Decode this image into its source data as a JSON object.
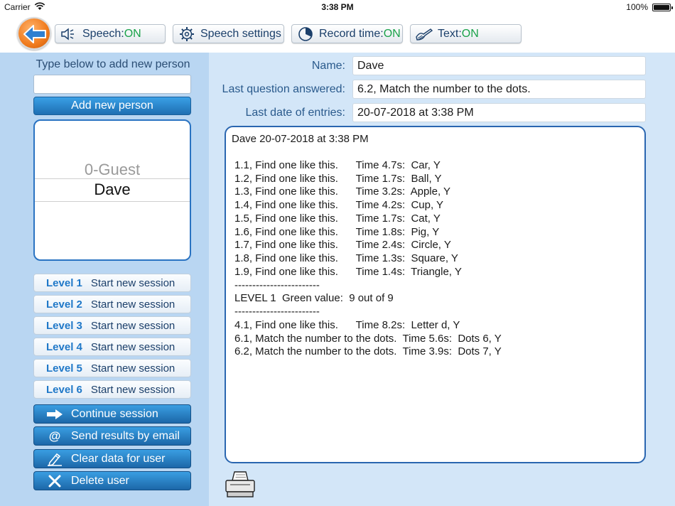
{
  "status_bar": {
    "carrier": "Carrier",
    "time": "3:38 PM",
    "battery": "100%"
  },
  "toolbar": {
    "speech": {
      "label": "Speech: ",
      "state": "ON"
    },
    "speech_settings": {
      "label": "Speech settings"
    },
    "record_time": {
      "label": "Record time: ",
      "state": "ON"
    },
    "text": {
      "label": "Text: ",
      "state": "ON"
    }
  },
  "sidebar": {
    "add_prompt": "Type below to add new person",
    "new_person_value": "",
    "add_button": "Add new person",
    "people": [
      "0-Guest",
      "Dave"
    ],
    "selected_person": "Dave",
    "levels": [
      {
        "level": "Level 1",
        "action": "Start new session"
      },
      {
        "level": "Level 2",
        "action": "Start new session"
      },
      {
        "level": "Level 3",
        "action": "Start new session"
      },
      {
        "level": "Level 4",
        "action": "Start new session"
      },
      {
        "level": "Level 5",
        "action": "Start new session"
      },
      {
        "level": "Level 6",
        "action": "Start new session"
      }
    ],
    "actions": {
      "continue": "Continue session",
      "email": "Send results by email",
      "clear": "Clear data for user",
      "delete": "Delete user"
    }
  },
  "main": {
    "name_label": "Name:",
    "name_value": "Dave",
    "last_question_label": "Last question answered:",
    "last_question_value": "6.2, Match the number to the dots.",
    "last_date_label": "Last date of entries:",
    "last_date_value": "20-07-2018 at 3:38 PM",
    "log_header": "Dave   20-07-2018 at 3:38 PM",
    "log_lines": [
      "1.1, Find one like this.      Time 4.7s:  Car, Y",
      "1.2, Find one like this.      Time 1.7s:  Ball, Y",
      "1.3, Find one like this.      Time 3.2s:  Apple, Y",
      "1.4, Find one like this.      Time 4.2s:  Cup, Y",
      "1.5, Find one like this.      Time 1.7s:  Cat, Y",
      "1.6, Find one like this.      Time 1.8s:  Pig, Y",
      "1.7, Find one like this.      Time 2.4s:  Circle, Y",
      "1.8, Find one like this.      Time 1.3s:  Square, Y",
      "1.9, Find one like this.      Time 1.4s:  Triangle, Y",
      "------------------------",
      "LEVEL 1  Green value:  9 out of 9",
      "------------------------",
      "4.1, Find one like this.      Time 8.2s:  Letter d, Y",
      "6.1, Match the number to the dots.  Time 5.6s:  Dots 6, Y",
      "6.2, Match the number to the dots.  Time 3.9s:  Dots 7, Y"
    ]
  }
}
